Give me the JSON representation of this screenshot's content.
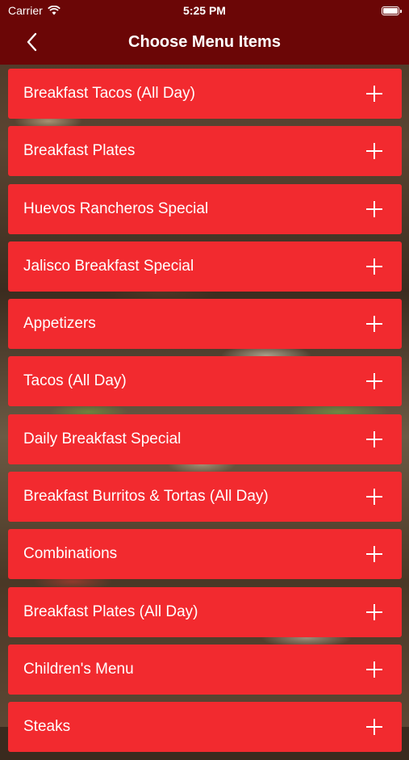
{
  "status_bar": {
    "carrier": "Carrier",
    "time": "5:25 PM"
  },
  "header": {
    "title": "Choose Menu Items",
    "back_icon": "chevron-left-icon"
  },
  "menu": {
    "items": [
      {
        "label": "Breakfast Tacos (All Day)"
      },
      {
        "label": "Breakfast Plates"
      },
      {
        "label": "Huevos Rancheros Special"
      },
      {
        "label": "Jalisco Breakfast Special"
      },
      {
        "label": "Appetizers"
      },
      {
        "label": "Tacos (All Day)"
      },
      {
        "label": "Daily Breakfast Special"
      },
      {
        "label": "Breakfast Burritos & Tortas (All Day)"
      },
      {
        "label": "Combinations"
      },
      {
        "label": "Breakfast Plates (All Day)"
      },
      {
        "label": "Children's Menu"
      },
      {
        "label": "Steaks"
      }
    ]
  },
  "colors": {
    "header": "#6b0606",
    "item": "#f22a2f"
  }
}
